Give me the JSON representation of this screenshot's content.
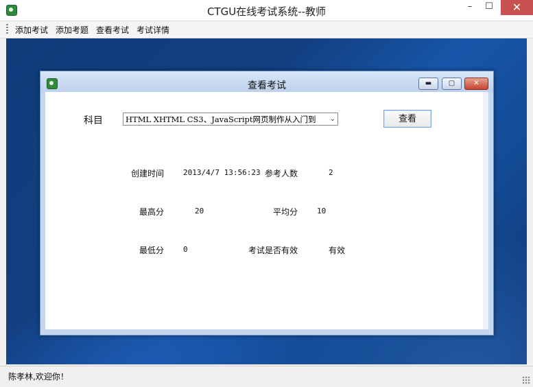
{
  "window": {
    "title": "CTGU在线考试系统--教师",
    "min_label": "–",
    "max_label": "☐",
    "close_label": "✕"
  },
  "menu": {
    "items": [
      "添加考试",
      "添加考题",
      "查看考试",
      "考试详情"
    ]
  },
  "child_window": {
    "title": "查看考试",
    "min_label": "▬",
    "max_label": "▢",
    "close_label": "✕"
  },
  "form": {
    "subject_label": "科目",
    "subject_value": "HTML XHTML CS3、JavaScript网页制作从入门到",
    "view_button": "查看"
  },
  "stats": {
    "created_label": "创建时间",
    "created_value": "2013/4/7 13:56:23",
    "participants_label": "参考人数",
    "participants_value": "2",
    "max_label": "最高分",
    "max_value": "20",
    "avg_label": "平均分",
    "avg_value": "10",
    "min_label": "最低分",
    "min_value": "0",
    "valid_label": "考试是否有效",
    "valid_value": "有效"
  },
  "status": {
    "text": "陈孝林,欢迎你！"
  },
  "colors": {
    "desktop": "#123f80",
    "close_button": "#c75050"
  }
}
